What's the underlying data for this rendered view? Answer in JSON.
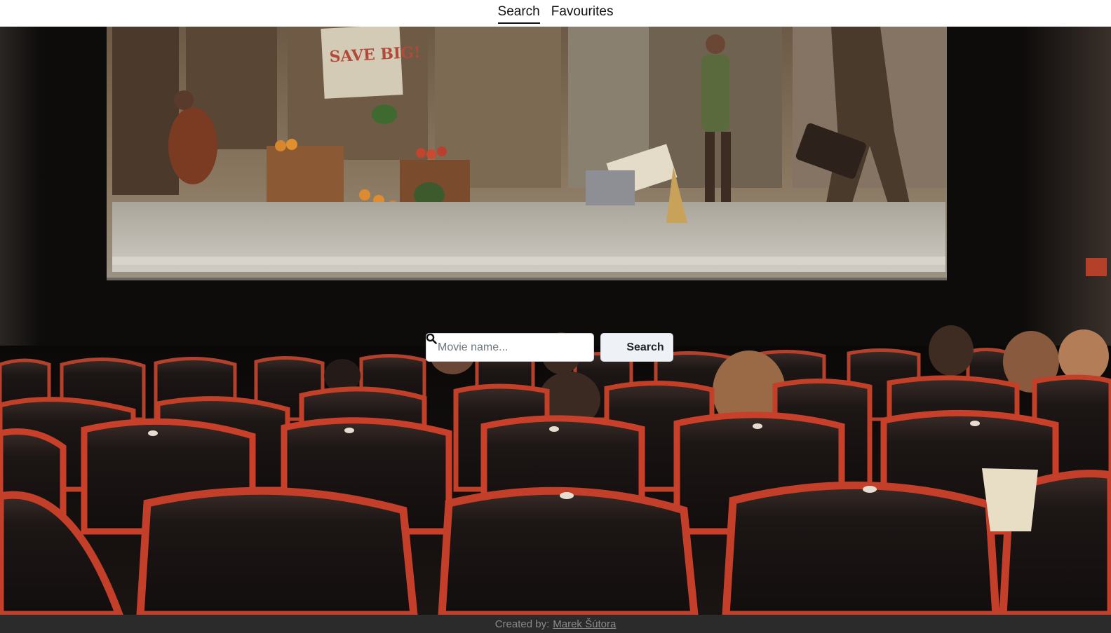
{
  "nav": {
    "items": [
      {
        "label": "Search",
        "active": true
      },
      {
        "label": "Favourites",
        "active": false
      }
    ]
  },
  "hero": {
    "screen_sign": "SAVE BIG!"
  },
  "search": {
    "placeholder": "Movie name...",
    "value": "",
    "button_label": "Search",
    "button_icon": "search-icon"
  },
  "footer": {
    "prefix": "Created by:",
    "author": "Marek Šútora"
  },
  "colors": {
    "seat_red": "#c83a26",
    "seat_dark": "#1c1716",
    "screen_floor": "#b9b6ad",
    "footer_bg": "#2b2b2b"
  }
}
